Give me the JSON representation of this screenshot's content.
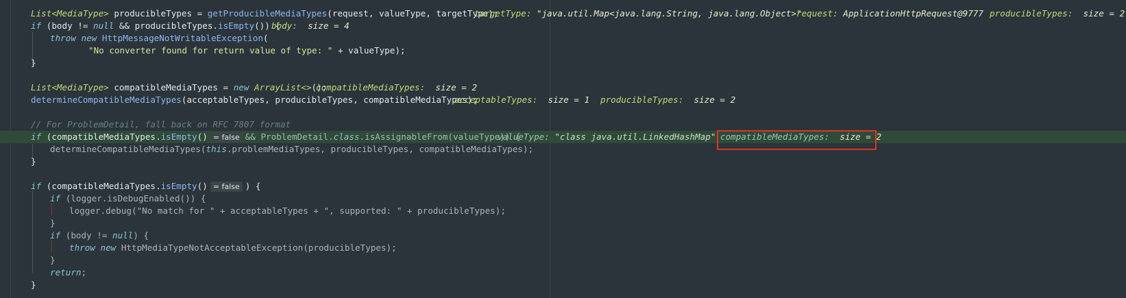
{
  "colors": {
    "background": "#2b343a",
    "exec_line": "#2f4a38",
    "highlight_box": "#e0331f"
  },
  "code": {
    "l1": {
      "type": "List<MediaType>",
      "decl": " producibleTypes = ",
      "call": "getProducibleMediaTypes",
      "args": "(request, valueType, targetType);",
      "hint1_name": "targetType:",
      "hint1_val": " \"java.util.Map<java.lang.String, java.lang.Object>\"",
      "hint2_name": "request:",
      "hint2_val": " ApplicationHttpRequest@9777",
      "hint3_name": "producibleTypes:",
      "hint3_val": "  size = 2"
    },
    "l2": {
      "kw_if": "if",
      "p1": " (body != ",
      "kw_null": "null",
      "p2": " && producibleTypes.",
      "meth": "isEmpty",
      "p3": "()) {",
      "hint_name": "body:",
      "hint_val": "  size = 4"
    },
    "l3": {
      "kw1": "throw",
      "kw2": "new",
      "cls": "HttpMessageNotWritableException",
      "p": "("
    },
    "l4": {
      "str": "\"No converter found for return value of type: \"",
      "p": " + valueType);"
    },
    "l5": {
      "brace": "}"
    },
    "l6": {
      "type": "List<MediaType>",
      "decl": " compatibleMediaTypes = ",
      "kw_new": "new",
      "cls": " ArrayList<>",
      "p": "();",
      "hint_name": "compatibleMediaTypes:",
      "hint_val": "  size = 2"
    },
    "l7": {
      "call": "determineCompatibleMediaTypes",
      "args": "(acceptableTypes, producibleTypes, compatibleMediaTypes);",
      "hint1_name": "acceptableTypes:",
      "hint1_val": "  size = 1",
      "hint2_name": "producibleTypes:",
      "hint2_val": "  size = 2"
    },
    "l8": {
      "comment": "// For ProblemDetail, fall back on RFC 7807 format"
    },
    "l9": {
      "kw_if": "if",
      "p1": " (compatibleMediaTypes.",
      "meth": "isEmpty",
      "p2": "()",
      "badge": "= false",
      "p3": "&& ProblemDetail.",
      "kw_class": "class",
      "p4": ".isAssignableFrom(valueType)) {",
      "hint1_name": "valueType:",
      "hint1_val": " \"class java.util.LinkedHashMap\"",
      "hint2_name": "compatibleMediaTypes:",
      "hint2_val": "  size = 2"
    },
    "l10": {
      "call": "determineCompatibleMediaTypes(",
      "kw_this": "this",
      "args": ".problemMediaTypes, producibleTypes, compatibleMediaTypes);"
    },
    "l11": {
      "brace": "}"
    },
    "l12": {
      "kw_if": "if",
      "p1": " (compatibleMediaTypes.",
      "meth": "isEmpty",
      "p2": "()",
      "badge": "= false",
      "p3": ") {"
    },
    "l13": {
      "kw_if": "if",
      "p": " (logger.isDebugEnabled()) {"
    },
    "l14": {
      "p1": "logger.debug(",
      "str1": "\"No match for \"",
      "p2": " + acceptableTypes + ",
      "str2": "\", supported: \"",
      "p3": " + producibleTypes);"
    },
    "l15": {
      "brace": "}"
    },
    "l16": {
      "kw_if": "if",
      "p1": " (body != ",
      "kw_null": "null",
      "p2": ") {"
    },
    "l17": {
      "kw1": "throw",
      "kw2": "new",
      "p": " HttpMediaTypeNotAcceptableException(producibleTypes);"
    },
    "l18": {
      "brace": "}"
    },
    "l19": {
      "kw_return": "return",
      "p": ";"
    },
    "l20": {
      "brace": "}"
    }
  }
}
